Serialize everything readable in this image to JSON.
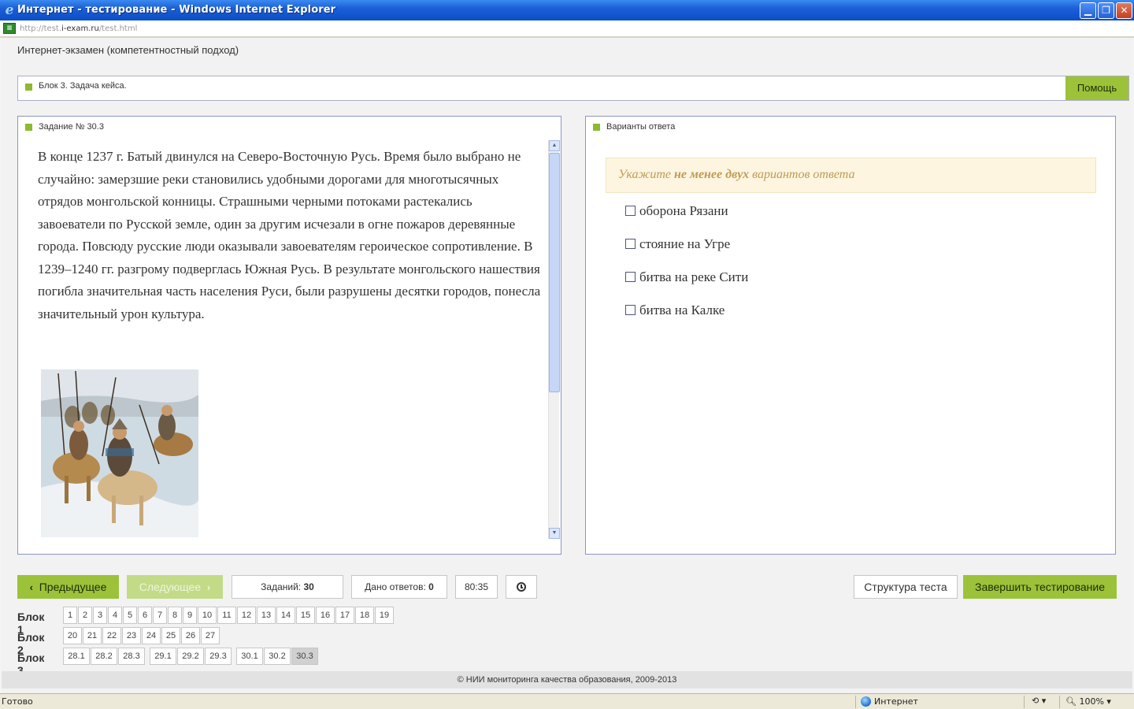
{
  "window": {
    "title": "Интернет - тестирование - Windows Internet Explorer",
    "minimize_glyph": "▁",
    "maximize_glyph": "❐",
    "close_glyph": "✕"
  },
  "address": {
    "url_prefix": "http://test.",
    "url_domain": "i-exam.ru",
    "url_suffix": "/test.html"
  },
  "app": {
    "title": "Интернет-экзамен (компетентностный подход)"
  },
  "block_header": {
    "label": "Блок 3. Задача кейса.",
    "help_label": "Помощь"
  },
  "task": {
    "label": "Задание № 30.3",
    "text": "В конце 1237 г. Батый двинулся на Северо-Восточную Русь. Время было выбрано не случайно: замерзшие реки становились удобными дорогами для многотысячных отрядов монгольской конницы. Страшными черными потоками растекались завоеватели по Русской земле, один за другим исчезали в огне пожаров деревянные города. Повсюду русские люди оказывали завоевателям героическое сопротивление. В 1239–1240 гг. разгрому подверглась Южная Русь. В результате монгольского нашествия погибла значительная часть населения Руси, были разрушены десятки городов, понесла значительный урон культура."
  },
  "answers": {
    "label": "Варианты ответа",
    "hint_before": "Укажите ",
    "hint_bold": "не менее двух",
    "hint_after": " вариантов ответа",
    "options": [
      {
        "label": "оборона Рязани",
        "checked": false
      },
      {
        "label": "стояние на Угре",
        "checked": false
      },
      {
        "label": "битва на реке Сити",
        "checked": false
      },
      {
        "label": "битва на Калке",
        "checked": false
      }
    ]
  },
  "controls": {
    "prev_label": "Предыдущее",
    "next_label": "Следующее",
    "tasks_label": "Заданий:",
    "tasks_count": "30",
    "answers_label": "Дано ответов:",
    "answers_count": "0",
    "timer": "80:35",
    "structure_label": "Структура теста",
    "finish_label": "Завершить тестирование"
  },
  "blocks": [
    {
      "label": "Блок 1",
      "items": [
        "1",
        "2",
        "3",
        "4",
        "5",
        "6",
        "7",
        "8",
        "9",
        "10",
        "11",
        "12",
        "13",
        "14",
        "15",
        "16",
        "17",
        "18",
        "19"
      ]
    },
    {
      "label": "Блок 2",
      "items": [
        "20",
        "21",
        "22",
        "23",
        "24",
        "25",
        "26",
        "27"
      ]
    },
    {
      "label": "Блок 3",
      "items": [
        "28.1",
        "28.2",
        "28.3",
        "29.1",
        "29.2",
        "29.3",
        "30.1",
        "30.2",
        "30.3"
      ],
      "active": "30.3"
    }
  ],
  "footer": {
    "text": "© НИИ мониторинга качества образования, 2009-2013"
  },
  "status": {
    "text": "Готово",
    "zone": "Интернет",
    "zoom": "100%"
  },
  "colors": {
    "accent": "#9cc23a",
    "panel_border": "#8a95c4",
    "hint_bg": "#fdf5e0",
    "hint_text": "#c19a52"
  }
}
